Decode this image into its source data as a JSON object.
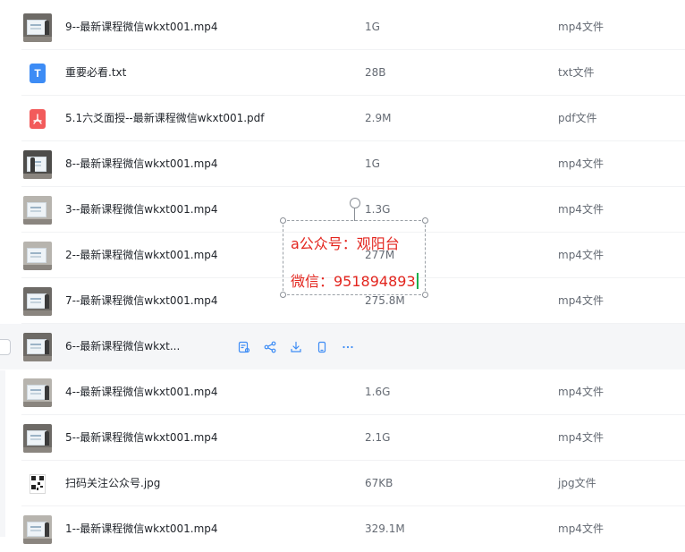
{
  "files": [
    {
      "thumb": "video-thumbnail",
      "name": "9--最新课程微信wkxt001.mp4",
      "size": "1G",
      "type": "mp4文件"
    },
    {
      "thumb": "txt-icon",
      "name": "重要必看.txt",
      "size": "28B",
      "type": "txt文件"
    },
    {
      "thumb": "pdf-icon",
      "name": "5.1六爻面授--最新课程微信wkxt001.pdf",
      "size": "2.9M",
      "type": "pdf文件"
    },
    {
      "thumb": "video-thumbnail",
      "name": "8--最新课程微信wkxt001.mp4",
      "size": "1G",
      "type": "mp4文件"
    },
    {
      "thumb": "video-thumbnail",
      "name": "3--最新课程微信wkxt001.mp4",
      "size": "1.3G",
      "type": "mp4文件"
    },
    {
      "thumb": "video-thumbnail",
      "name": "2--最新课程微信wkxt001.mp4",
      "size": "277M",
      "type": "mp4文件"
    },
    {
      "thumb": "video-thumbnail",
      "name": "7--最新课程微信wkxt001.mp4",
      "size": "275.8M",
      "type": "mp4文件"
    },
    {
      "thumb": "video-thumbnail",
      "name": "6--最新课程微信wkxt...",
      "size": "",
      "type": "",
      "hovered": true
    },
    {
      "thumb": "video-thumbnail",
      "name": "4--最新课程微信wkxt001.mp4",
      "size": "1.6G",
      "type": "mp4文件"
    },
    {
      "thumb": "video-thumbnail",
      "name": "5--最新课程微信wkxt001.mp4",
      "size": "2.1G",
      "type": "mp4文件"
    },
    {
      "thumb": "qr-code-thumbnail",
      "name": "扫码关注公众号.jpg",
      "size": "67KB",
      "type": "jpg文件"
    },
    {
      "thumb": "video-thumbnail",
      "name": "1--最新课程微信wkxt001.mp4",
      "size": "329.1M",
      "type": "mp4文件"
    }
  ],
  "hover_actions": [
    "image-text-icon",
    "share-icon",
    "download-icon",
    "phone-icon",
    "more-icon"
  ],
  "annotation": {
    "line1": "a公众号：观阳台",
    "line2": "微信：951894893",
    "color": "#e3261f"
  },
  "icons": {
    "txt_glyph": "T",
    "pdf_glyph": "⅄"
  },
  "colors": {
    "hover_row": "#f5f6f8",
    "accent": "#3d8cf5",
    "txt_icon": "#3d8cf5",
    "pdf_icon": "#f25b5b"
  }
}
